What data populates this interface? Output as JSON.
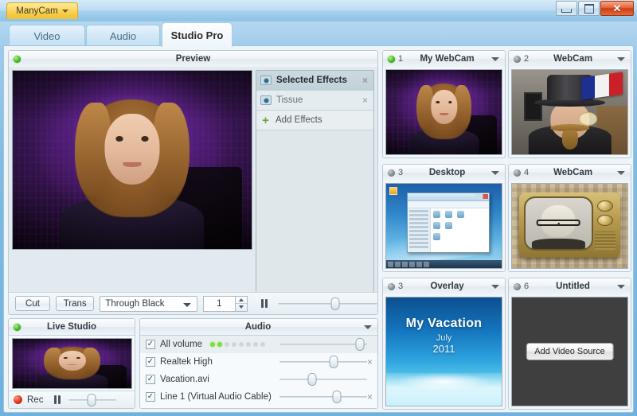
{
  "window": {
    "app_button": "ManyCam",
    "minimize_icon": "minimize-icon",
    "maximize_icon": "maximize-icon",
    "close_label": "✕"
  },
  "tabs": [
    {
      "label": "Video",
      "active": false
    },
    {
      "label": "Audio",
      "active": false
    },
    {
      "label": "Studio Pro",
      "active": true
    }
  ],
  "preview": {
    "title": "Preview",
    "status": "on",
    "effects": {
      "header": "Selected Effects",
      "items": [
        {
          "label": "Tissue",
          "close": "×"
        }
      ],
      "header_close": "×",
      "add_label": "Add Effects",
      "add_icon": "plus-icon"
    },
    "toolbar": {
      "cut_label": "Cut",
      "trans_label": "Trans",
      "transition_value": "Through Black",
      "duration_value": "1",
      "pause_icon": "pause-icon"
    }
  },
  "live_studio": {
    "title": "Live Studio",
    "status": "on",
    "rec_label": "Rec",
    "pause_icon": "pause-icon"
  },
  "audio": {
    "title": "Audio",
    "caret_icon": "chevron-down-icon",
    "rows": [
      {
        "name": "All volume",
        "checked": true,
        "meter_on": 2,
        "meter_total": 8,
        "has_close": false,
        "slider_pct": 92
      },
      {
        "name": "Realtek High",
        "checked": true,
        "has_close": true,
        "close": "×",
        "slider_pct": 62
      },
      {
        "name": "Vacation.avi",
        "checked": true,
        "has_close": false,
        "slider_pct": 37
      },
      {
        "name": "Line 1 (Virtual Audio Cable)",
        "checked": true,
        "has_close": true,
        "close": "×",
        "slider_pct": 65
      }
    ]
  },
  "sources": [
    {
      "num": "1",
      "title": "My WebCam",
      "status": "on"
    },
    {
      "num": "2",
      "title": "WebCam",
      "status": "off"
    },
    {
      "num": "3",
      "title": "Desktop",
      "status": "off"
    },
    {
      "num": "4",
      "title": "WebCam",
      "status": "off"
    },
    {
      "num": "3",
      "title": "Overlay",
      "status": "off"
    },
    {
      "num": "6",
      "title": "Untitled",
      "status": "off"
    }
  ],
  "overlay": {
    "title": "My Vacation",
    "month": "July",
    "year": "2011"
  },
  "untitled": {
    "add_button": "Add Video Source"
  },
  "colors": {
    "accent_blue": "#7fbbe3",
    "brand_yellow": "#f5c944",
    "close_red": "#cf3d14",
    "led_green": "#4fca2c",
    "rec_red": "#e23b1f"
  }
}
